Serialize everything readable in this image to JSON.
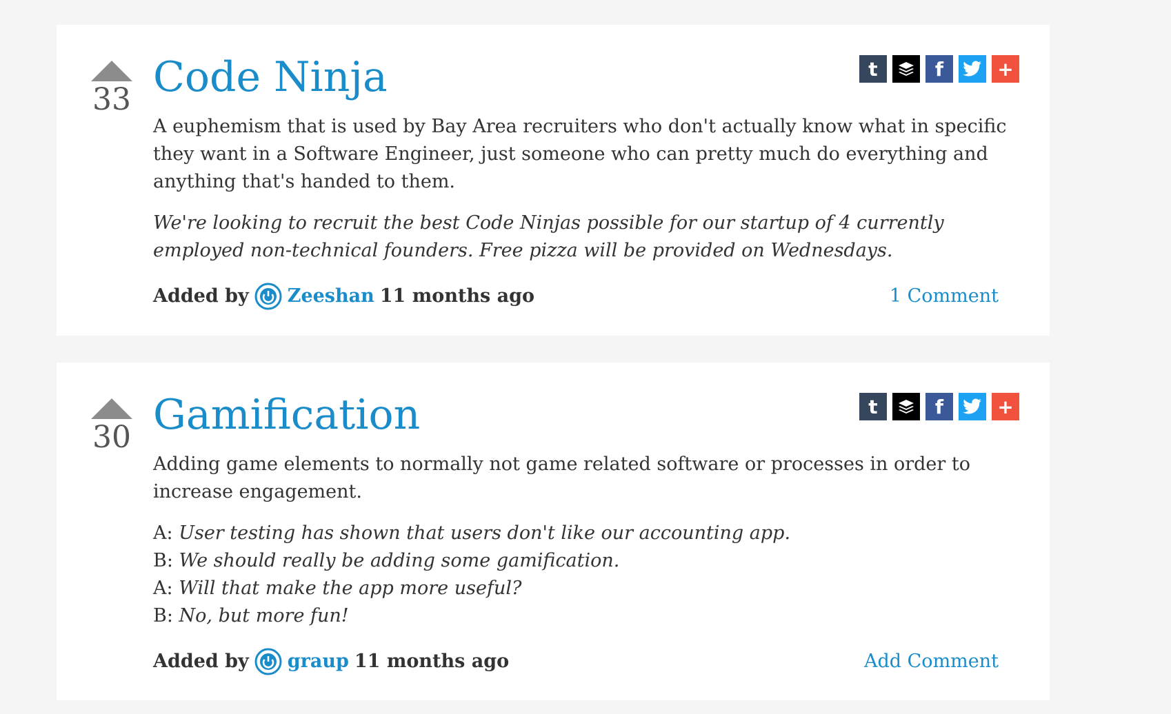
{
  "colors": {
    "link": "#1a8cc9",
    "background": "#f6f5f5",
    "card": "#ffffff",
    "vote_arrow": "#8c8c8c",
    "tumblr": "#36465d",
    "buffer": "#000000",
    "facebook": "#3b5998",
    "twitter": "#1da1f2",
    "more": "#f0523d"
  },
  "share_icons": [
    "tumblr-icon",
    "buffer-icon",
    "facebook-icon",
    "twitter-icon",
    "plus-icon"
  ],
  "entries": [
    {
      "title": "Code Ninja",
      "votes": "33",
      "definition": "A euphemism that is used by Bay Area recruiters who don't actually know what in specific they want in a Software Engineer, just someone who can pretty much do everything and anything that's handed to them.",
      "example": "We're looking to recruit the best Code Ninjas possible for our startup of 4 currently employed non-technical founders. Free pizza will be provided on Wednesdays.",
      "added_by_label": "Added by",
      "author": "Zeeshan",
      "time_ago": "11 months ago",
      "comment_link": "1 Comment"
    },
    {
      "title": "Gamification",
      "votes": "30",
      "definition": "Adding game elements to normally not game related software or processes in order to increase engagement.",
      "example_lines": [
        {
          "speaker": "A:",
          "text": "User testing has shown that users don't like our accounting app."
        },
        {
          "speaker": "B:",
          "text": "We should really be adding some gamification."
        },
        {
          "speaker": "A:",
          "text": "Will that make the app more useful?"
        },
        {
          "speaker": "B:",
          "text": "No, but more fun!"
        }
      ],
      "added_by_label": "Added by",
      "author": "graup",
      "time_ago": "11 months ago",
      "comment_link": "Add Comment"
    }
  ]
}
